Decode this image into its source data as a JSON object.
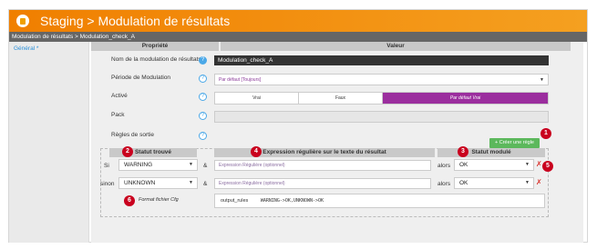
{
  "title_bar": {
    "title": "Staging > Modulation de résultats",
    "icon": "trash-can-icon"
  },
  "breadcrumb": "Modulation de résultats > Modulation_check_A",
  "sidebar": {
    "tab_label": "Général *"
  },
  "table_header": {
    "property": "Propriété",
    "value": "Valeur"
  },
  "fields": {
    "name": {
      "label": "Nom de la modulation de résultats",
      "required_mark": "*",
      "value": "Modulation_check_A"
    },
    "period": {
      "label": "Période de Modulation",
      "value": "Par défaut [Toujours]"
    },
    "active": {
      "label": "Activé",
      "options": [
        "Vrai",
        "Faux",
        "Par défaut Vrai"
      ],
      "selected_index": 2
    },
    "pack": {
      "label": "Pack",
      "value": ""
    },
    "rules": {
      "label": "Règles de sortie"
    }
  },
  "create_rule_button": "+ Créer une règle",
  "rules_header": {
    "status_found": "Statut trouvé",
    "regex": "Expression régulière sur le texte du résultat",
    "status_modulated": "Statut modulé"
  },
  "rules": [
    {
      "prefix": "Si",
      "status": "WARNING",
      "amp": "&",
      "regex_placeholder": "Expression Régulière (optionnel)",
      "then": "alors",
      "result": "OK"
    },
    {
      "prefix": "sinon",
      "status": "UNKNOWN",
      "amp": "&",
      "regex_placeholder": "Expression Régulière (optionnel)",
      "then": "alors",
      "result": "OK"
    }
  ],
  "cfg": {
    "label": "Format fichier Cfg",
    "key": "output_rules",
    "value": "WARNING->OK,UNKNOWN->OK"
  },
  "badges": [
    "1",
    "2",
    "3",
    "4",
    "5",
    "6"
  ],
  "help_mark": "?",
  "caret": "▼",
  "delete_mark": "✗",
  "colors": {
    "title_orange": "#f07f00",
    "active_purple": "#9b2e9e",
    "badge_red": "#c9001e",
    "create_green": "#5cb85c",
    "help_blue": "#4aa8e8"
  }
}
